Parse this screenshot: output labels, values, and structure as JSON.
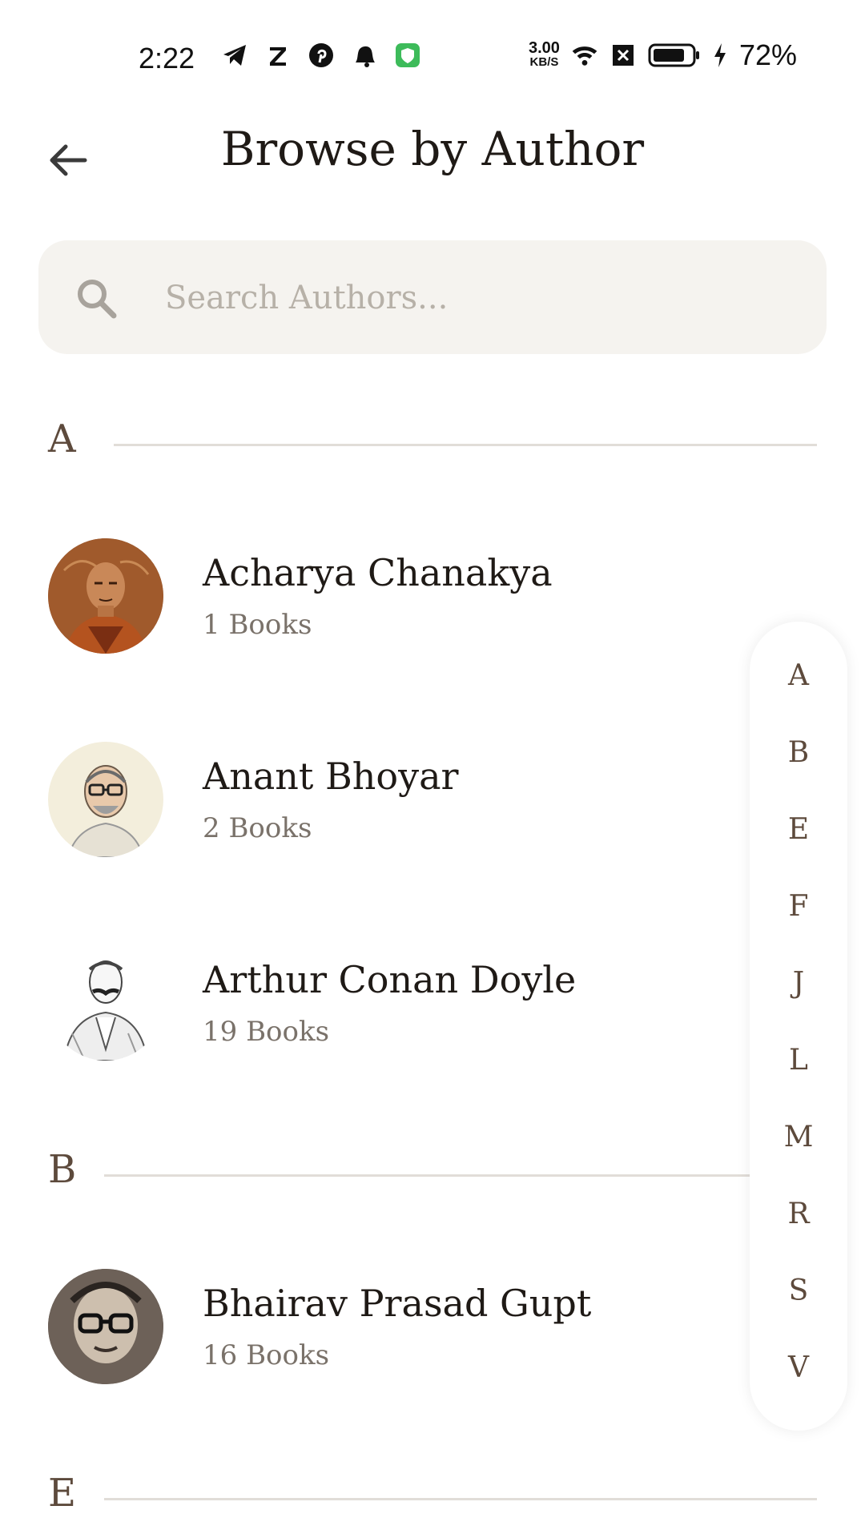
{
  "status_bar": {
    "time": "2:22",
    "speed_value": "3.00",
    "speed_unit": "KB/S",
    "battery_percent": "72%",
    "icons": [
      "telegram-icon",
      "z-icon",
      "pinterest-icon",
      "notification-bell-icon",
      "shield-app-icon",
      "wifi-icon",
      "no-sim-icon",
      "battery-icon",
      "charging-icon"
    ]
  },
  "header": {
    "title": "Browse by Author",
    "back_icon": "arrow-left-icon"
  },
  "search": {
    "placeholder": "Search Authors...",
    "icon": "search-icon"
  },
  "sections": [
    {
      "letter": "A",
      "authors": [
        {
          "name": "Acharya Chanakya",
          "count": "1 Books"
        },
        {
          "name": "Anant Bhoyar",
          "count": "2 Books"
        },
        {
          "name": "Arthur Conan Doyle",
          "count": "19 Books"
        }
      ]
    },
    {
      "letter": "B",
      "authors": [
        {
          "name": "Bhairav Prasad Gupt",
          "count": "16 Books"
        }
      ]
    },
    {
      "letter": "E",
      "authors": []
    }
  ],
  "alphabet_index": [
    "A",
    "B",
    "E",
    "F",
    "J",
    "L",
    "M",
    "R",
    "S",
    "V"
  ],
  "colors": {
    "accent_letter": "#5d4a3c",
    "search_bg": "#f5f3ef",
    "divider": "#e1ddd8"
  }
}
